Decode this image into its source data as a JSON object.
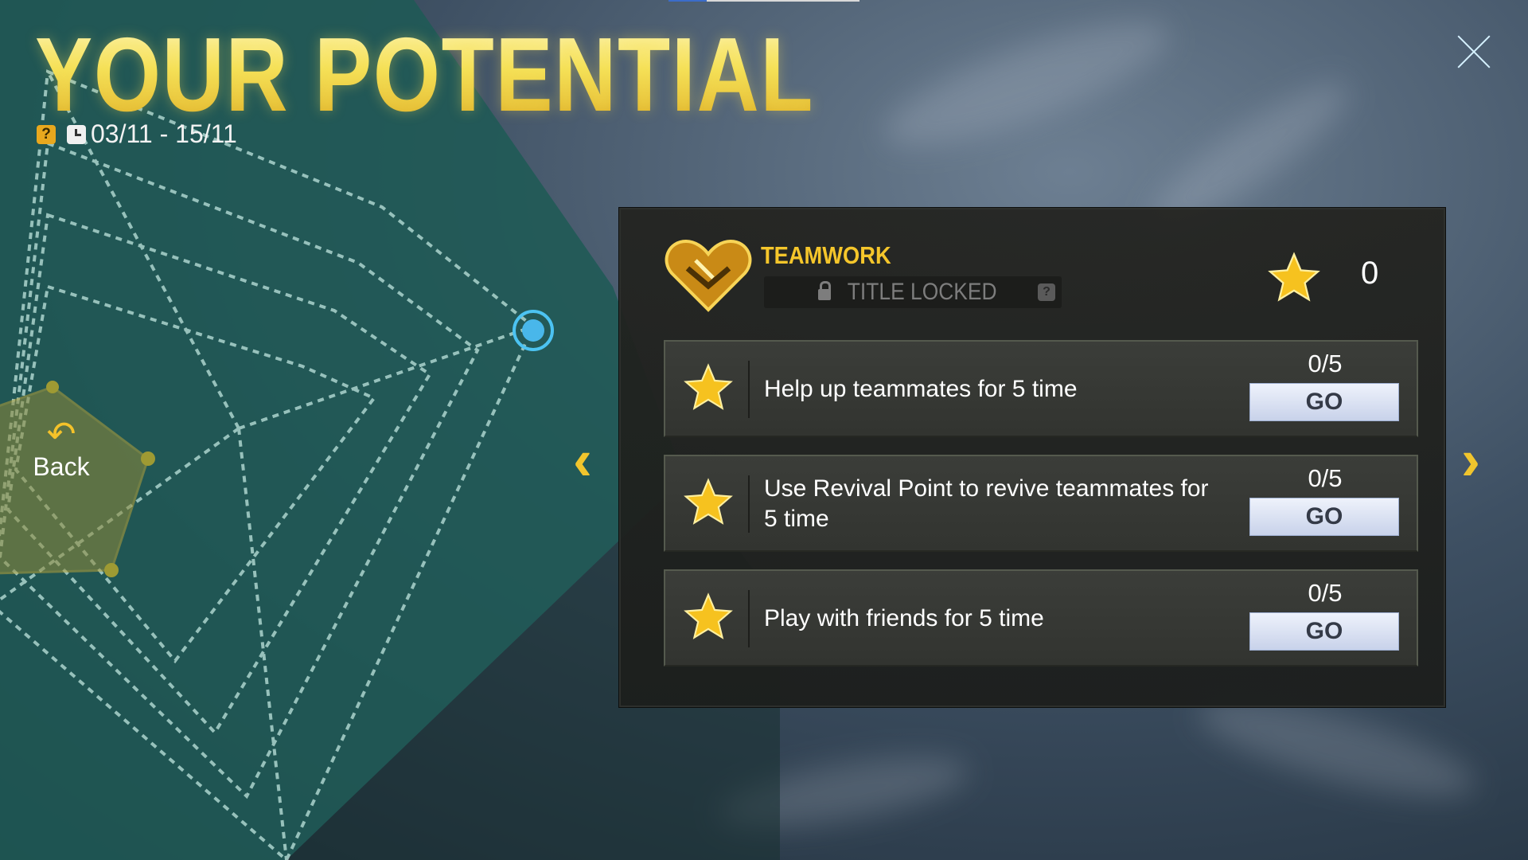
{
  "header": {
    "title": "YOUR POTENTIAL",
    "help_icon": "question-icon",
    "clock_icon": "clock-icon",
    "date_range": "03/11 - 15/11"
  },
  "nav": {
    "back_label": "Back",
    "back_icon": "return-arrow-icon",
    "prev_icon": "chevron-left-icon",
    "next_icon": "chevron-right-icon",
    "close_icon": "close-icon"
  },
  "category": {
    "name": "TEAMWORK",
    "emblem_icon": "handshake-heart-emblem",
    "locked_label": "TITLE LOCKED",
    "locked_help_icon": "question-icon",
    "score": "0",
    "score_icon": "star-icon"
  },
  "tasks": [
    {
      "text": "Help up teammates for 5 time",
      "progress": "0/5",
      "button": "GO"
    },
    {
      "text": "Use Revival Point to revive teammates for 5 time",
      "progress": "0/5",
      "button": "GO"
    },
    {
      "text": "Play with friends for 5 time",
      "progress": "0/5",
      "button": "GO"
    }
  ],
  "colors": {
    "accent_gold": "#f5c62b",
    "radar_teal": "#1f5f5a",
    "node_blue": "#3fb6ea",
    "go_button": "#dfe6f6"
  }
}
